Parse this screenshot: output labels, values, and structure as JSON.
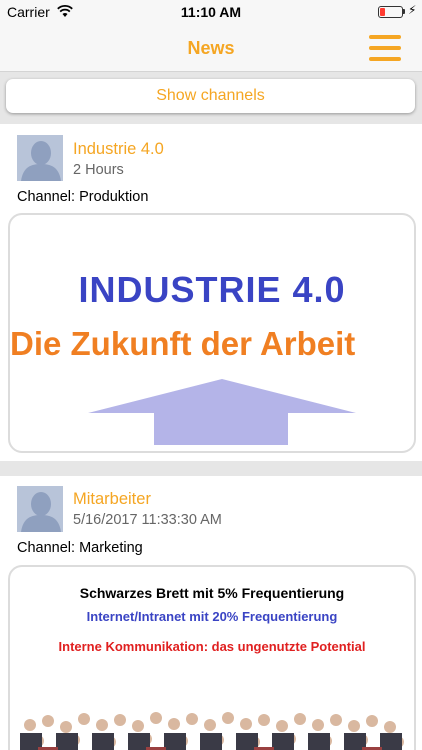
{
  "status_bar": {
    "carrier": "Carrier",
    "time": "11:10 AM"
  },
  "nav": {
    "title": "News"
  },
  "channels_button": {
    "label": "Show channels"
  },
  "posts": [
    {
      "title": "Industrie 4.0",
      "time": "2 Hours",
      "channel": "Channel: Produktion",
      "image": {
        "headline": "INDUSTRIE 4.0",
        "subline": "Die Zukunft der Arbeit"
      }
    },
    {
      "title": "Mitarbeiter",
      "time": "5/16/2017 11:33:30 AM",
      "channel": "Channel: Marketing",
      "image": {
        "line1": "Schwarzes Brett mit  5%  Frequentierung",
        "line2": "Internet/Intranet mit 20%  Frequentierung",
        "line3": "Interne Kommunikation: das ungenutzte Potential"
      }
    }
  ],
  "colors": {
    "accent": "#f5a623",
    "headline_blue": "#3a44c4",
    "subline_orange": "#f07f22",
    "red_text": "#e02020"
  }
}
